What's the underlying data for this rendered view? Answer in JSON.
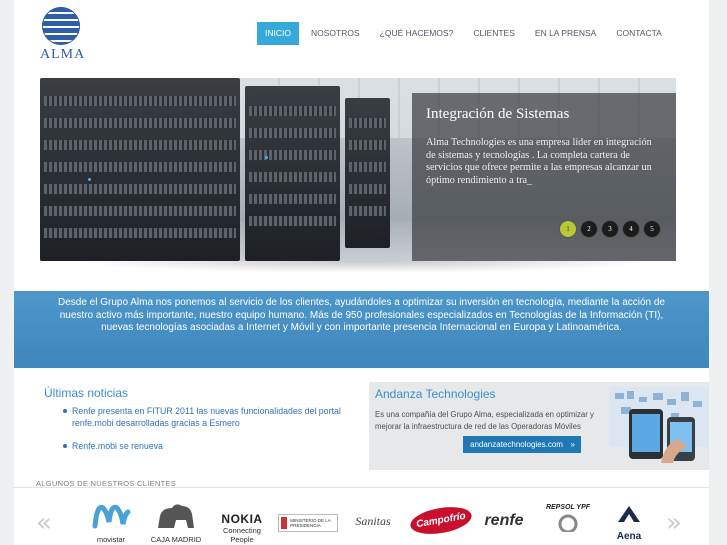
{
  "logo": {
    "text": "ALMA"
  },
  "nav": {
    "items": [
      {
        "label": "INICIO",
        "active": true
      },
      {
        "label": "NOSOTROS"
      },
      {
        "label": "¿QUÉ HACEMOS?"
      },
      {
        "label": "CLIENTES"
      },
      {
        "label": "EN LA PRENSA"
      },
      {
        "label": "CONTACTA"
      }
    ]
  },
  "slider": {
    "title": "Integración de Sistemas",
    "text": "Alma Technologies es una empresa líder en integración de sistemas y tecnologías . La completa cartera de servicios que ofrece permite a las empresas alcanzar un óptimo rendimiento a tra_",
    "dots": [
      "1",
      "2",
      "3",
      "4",
      "5"
    ],
    "active_dot": 0
  },
  "intro": {
    "text": "Desde el Grupo Alma nos ponemos al servicio de los clientes, ayudándoles a optimizar su inversión en tecnología, mediante la acción de nuestro activo más importante, nuestro equipo humano. Más de 950 profesionales especializados en Tecnologías de la Información (TI), nuevas tecnologías asociadas a Internet y Móvil y con importante presencia Internacional en Europa y Latinoamérica."
  },
  "news": {
    "title": "Últimas noticias",
    "items": [
      "Renfe presenta en FITUR 2011 las nuevas funcionalidades del portal renfe.mobi desarrolladas gracias a Esmero",
      "Renfe.mobi se renueva"
    ]
  },
  "andanza": {
    "title": "Andanza Technologies",
    "text": "Es una compañía del Grupo Alma, especializada en optimizar y mejorar la infraestructura de red de las Operadoras Móviles",
    "button": "andanzatechnologies.com",
    "button_arrow": "»"
  },
  "clients": {
    "label": "ALGUNOS DE NUESTROS CLIENTES",
    "prev": "«",
    "next": "»",
    "logos": [
      {
        "name": "movistar"
      },
      {
        "name": "CAJA MADRID"
      },
      {
        "name": "NOKIA",
        "sub": "Connecting People"
      },
      {
        "name": "MINISTERIO DE LA PRESIDENCIA"
      },
      {
        "name": "Sanitas"
      },
      {
        "name": "Campofrío"
      },
      {
        "name": "renfe"
      },
      {
        "name": "REPSOL YPF"
      },
      {
        "name": "Aena"
      }
    ]
  },
  "colors": {
    "accent": "#36a9d9",
    "band": "#4a92c6",
    "link": "#2f73b5"
  }
}
